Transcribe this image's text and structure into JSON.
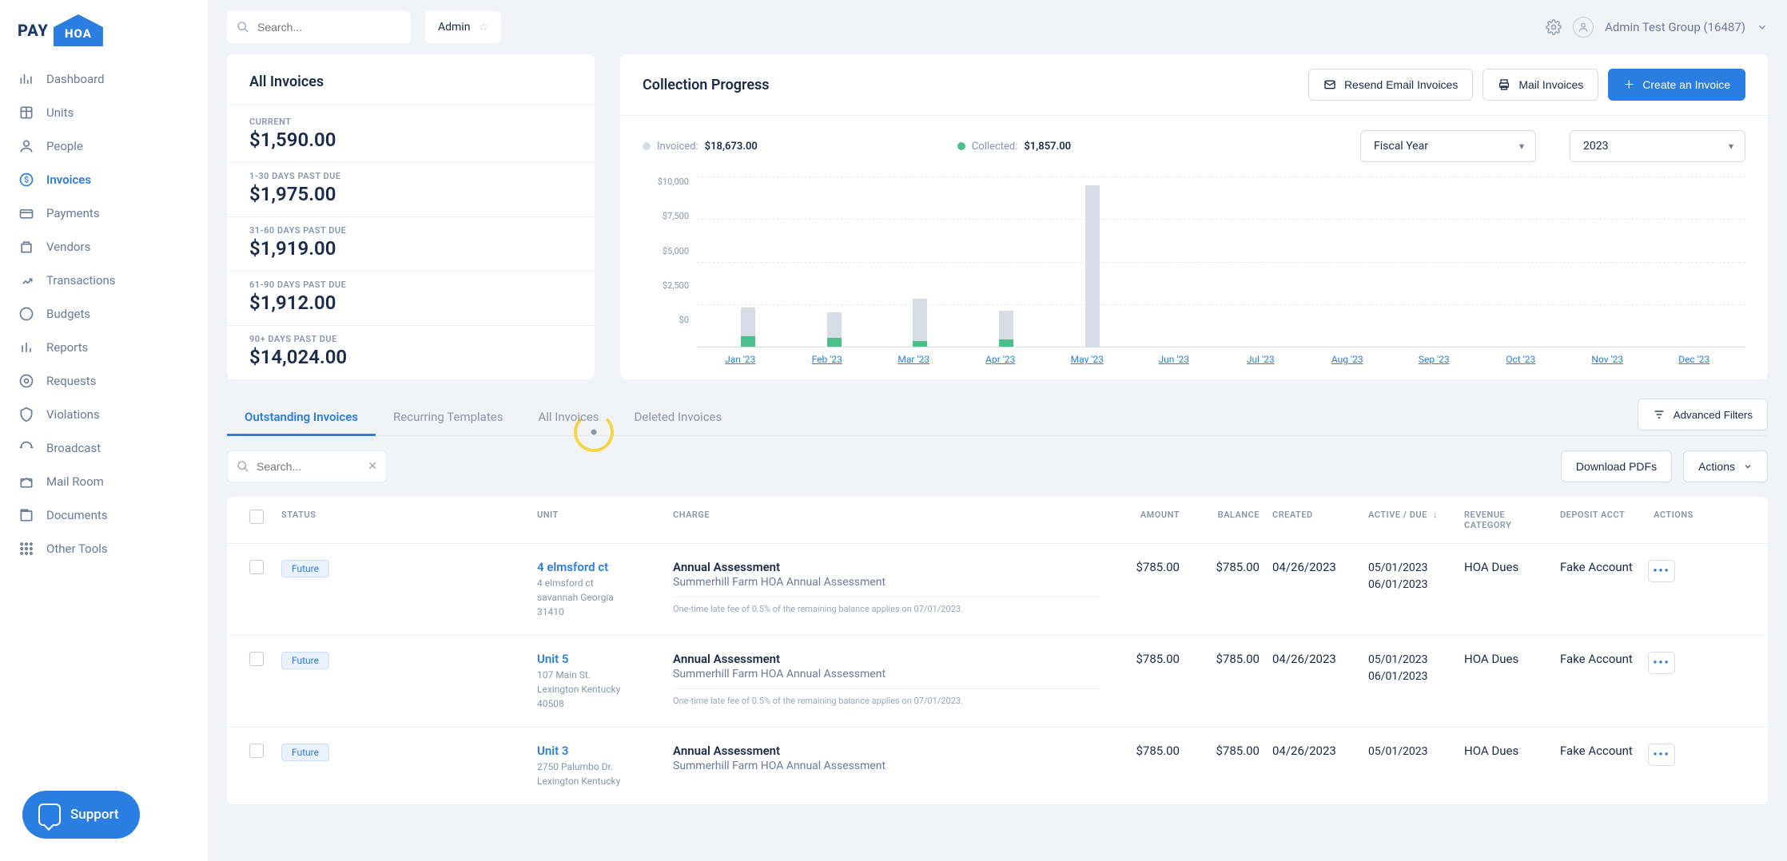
{
  "brand": {
    "left": "PAY",
    "right": "HOA"
  },
  "sidebar": {
    "items": [
      {
        "label": "Dashboard"
      },
      {
        "label": "Units"
      },
      {
        "label": "People"
      },
      {
        "label": "Invoices"
      },
      {
        "label": "Payments"
      },
      {
        "label": "Vendors"
      },
      {
        "label": "Transactions"
      },
      {
        "label": "Budgets"
      },
      {
        "label": "Reports"
      },
      {
        "label": "Requests"
      },
      {
        "label": "Violations"
      },
      {
        "label": "Broadcast"
      },
      {
        "label": "Mail Room"
      },
      {
        "label": "Documents"
      },
      {
        "label": "Other Tools"
      }
    ]
  },
  "topbar": {
    "search_placeholder": "Search...",
    "admin_label": "Admin",
    "user_label": "Admin Test Group (16487)"
  },
  "all_invoices": {
    "title": "All Invoices",
    "rows": [
      {
        "label": "CURRENT",
        "amount": "$1,590.00"
      },
      {
        "label": "1-30 DAYS PAST DUE",
        "amount": "$1,975.00"
      },
      {
        "label": "31-60 DAYS PAST DUE",
        "amount": "$1,919.00"
      },
      {
        "label": "61-90 DAYS PAST DUE",
        "amount": "$1,912.00"
      },
      {
        "label": "90+ DAYS PAST DUE",
        "amount": "$14,024.00"
      }
    ]
  },
  "progress": {
    "title": "Collection Progress",
    "resend_label": "Resend Email Invoices",
    "mail_label": "Mail Invoices",
    "create_label": "Create an Invoice",
    "invoiced_label": "Invoiced:",
    "invoiced_value": "$18,673.00",
    "collected_label": "Collected:",
    "collected_value": "$1,857.00",
    "fiscal_label": "Fiscal Year",
    "year_label": "2023"
  },
  "chart_data": {
    "type": "bar",
    "title": "Collection Progress",
    "ylabel": "",
    "xlabel": "",
    "ylim": [
      0,
      10000
    ],
    "y_ticks": [
      "$10,000",
      "$7,500",
      "$5,000",
      "$2,500",
      "$0"
    ],
    "categories": [
      "Jan '23",
      "Feb '23",
      "Mar '23",
      "Apr '23",
      "May '23",
      "Jun '23",
      "Jul '23",
      "Aug '23",
      "Sep '23",
      "Oct '23",
      "Nov '23",
      "Dec '23"
    ],
    "series": [
      {
        "name": "Invoiced",
        "color": "#d5dce6",
        "values": [
          2300,
          2000,
          2800,
          2100,
          9500,
          0,
          0,
          0,
          0,
          0,
          0,
          0
        ]
      },
      {
        "name": "Collected",
        "color": "#4abf8a",
        "values": [
          600,
          500,
          350,
          400,
          0,
          0,
          0,
          0,
          0,
          0,
          0,
          0
        ]
      }
    ]
  },
  "tabs": {
    "items": [
      "Outstanding Invoices",
      "Recurring Templates",
      "All Invoices",
      "Deleted Invoices"
    ],
    "advanced_filters": "Advanced Filters"
  },
  "table_toolbar": {
    "search_placeholder": "Search...",
    "download_label": "Download PDFs",
    "actions_label": "Actions"
  },
  "table": {
    "headers": {
      "status": "STATUS",
      "unit": "UNIT",
      "charge": "CHARGE",
      "amount": "AMOUNT",
      "balance": "BALANCE",
      "created": "CREATED",
      "active_due": "ACTIVE / DUE",
      "revenue": "REVENUE CATEGORY",
      "deposit": "DEPOSIT ACCT",
      "actions": "ACTIONS"
    },
    "rows": [
      {
        "status": "Future",
        "unit_name": "4 elmsford ct",
        "unit_addr": "4 elmsford ct\nsavannah Georgia\n31410",
        "charge_title": "Annual Assessment",
        "charge_sub": "Summerhill Farm HOA Annual Assessment",
        "charge_note": "One-time late fee of 0.5% of the remaining balance applies on 07/01/2023.",
        "amount": "$785.00",
        "balance": "$785.00",
        "created": "04/26/2023",
        "active": "05/01/2023",
        "due": "06/01/2023",
        "revenue": "HOA Dues",
        "deposit": "Fake Account"
      },
      {
        "status": "Future",
        "unit_name": "Unit 5",
        "unit_addr": "107 Main St.\nLexington Kentucky\n40508",
        "charge_title": "Annual Assessment",
        "charge_sub": "Summerhill Farm HOA Annual Assessment",
        "charge_note": "One-time late fee of 0.5% of the remaining balance applies on 07/01/2023.",
        "amount": "$785.00",
        "balance": "$785.00",
        "created": "04/26/2023",
        "active": "05/01/2023",
        "due": "06/01/2023",
        "revenue": "HOA Dues",
        "deposit": "Fake Account"
      },
      {
        "status": "Future",
        "unit_name": "Unit 3",
        "unit_addr": "2750 Palumbo Dr.\nLexington Kentucky",
        "charge_title": "Annual Assessment",
        "charge_sub": "Summerhill Farm HOA Annual Assessment",
        "charge_note": "",
        "amount": "$785.00",
        "balance": "$785.00",
        "created": "04/26/2023",
        "active": "05/01/2023",
        "due": "",
        "revenue": "HOA Dues",
        "deposit": "Fake Account"
      }
    ]
  },
  "support": {
    "label": "Support"
  }
}
